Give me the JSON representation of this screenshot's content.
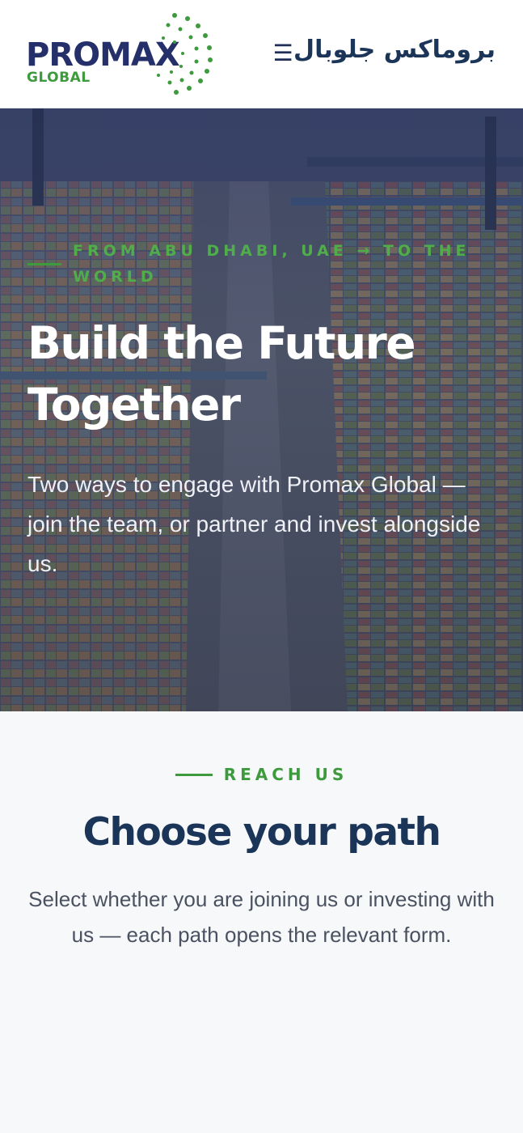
{
  "header": {
    "logo_primary": "PROMAX",
    "logo_secondary": "GLOBAL",
    "menu_icon": "☰",
    "arabic_brand": "بروماكس جلوبال"
  },
  "hero": {
    "eyebrow": "From Abu Dhabi, UAE → to the World",
    "title": "Build the Future Together",
    "description": "Two ways to engage with Promax Global — join the team, or partner and invest alongside us."
  },
  "reach": {
    "eyebrow": "REACH US",
    "title": "Choose your path",
    "description": "Select whether you are joining us or investing with us — each path opens the relevant form."
  },
  "colors": {
    "brand_navy": "#25306b",
    "brand_green": "#3d9a3d",
    "heading_navy": "#1b3559"
  }
}
